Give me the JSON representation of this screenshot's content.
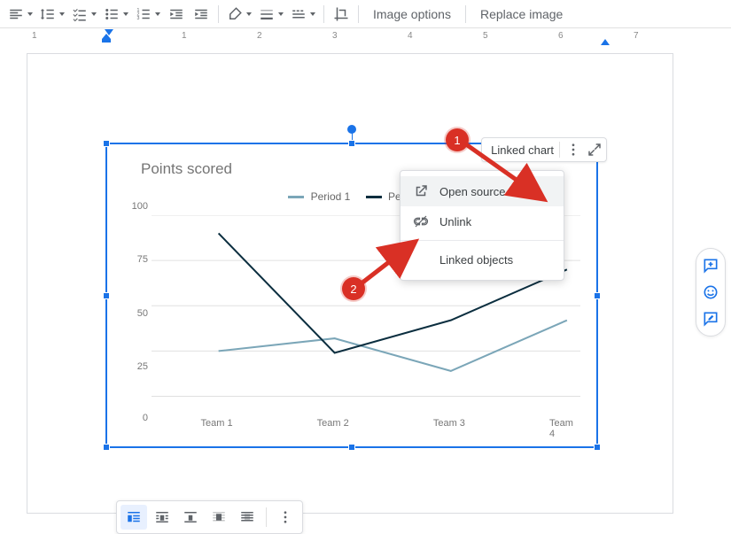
{
  "toolbar": {
    "image_options": "Image options",
    "replace_image": "Replace image"
  },
  "ruler": {
    "numbers": [
      "1",
      "1",
      "2",
      "3",
      "4",
      "5",
      "6",
      "7"
    ]
  },
  "chart": {
    "title": "Points scored",
    "legend": [
      "Period 1",
      "Period 2"
    ],
    "y_ticks": [
      "0",
      "25",
      "50",
      "75",
      "100"
    ],
    "x_labels": [
      "Team 1",
      "Team 2",
      "Team 3",
      "Team 4"
    ]
  },
  "chart_data": {
    "type": "line",
    "title": "Points scored",
    "xlabel": "",
    "ylabel": "",
    "ylim": [
      0,
      100
    ],
    "categories": [
      "Team 1",
      "Team 2",
      "Team 3",
      "Team 4"
    ],
    "series": [
      {
        "name": "Period 1",
        "values": [
          25,
          32,
          14,
          42
        ]
      },
      {
        "name": "Period 2",
        "values": [
          90,
          24,
          42,
          70
        ]
      }
    ]
  },
  "linked_chip": {
    "label": "Linked chart"
  },
  "menu": {
    "open_source": "Open source",
    "unlink": "Unlink",
    "linked_objects": "Linked objects"
  },
  "annotations": {
    "badge1": "1",
    "badge2": "2"
  }
}
